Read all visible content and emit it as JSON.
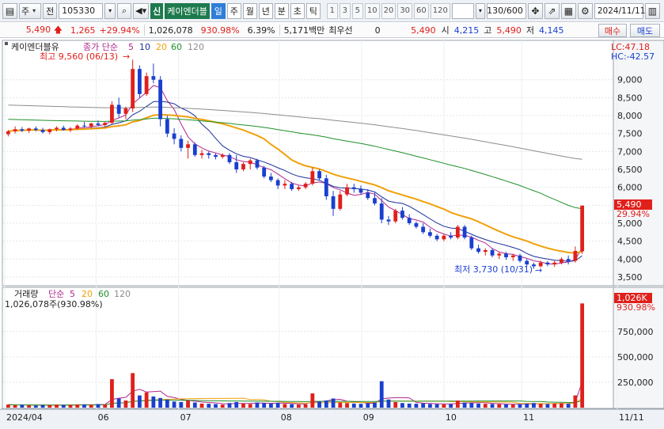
{
  "toolbar": {
    "market_label": "주",
    "type_label": "전",
    "code": "105330",
    "new_tag": "신",
    "stock_name": "케이엔더블",
    "periods": [
      "일",
      "주",
      "월",
      "년",
      "분",
      "초",
      "틱"
    ],
    "numbers": [
      "1",
      "3",
      "5",
      "10",
      "20",
      "30",
      "60",
      "120"
    ],
    "count_display": "130/600",
    "date": "2024/11/11"
  },
  "quote": {
    "price": "5,490",
    "change": "1,265",
    "change_pct": "+29.94%",
    "volume": "1,026,078",
    "volume_ratio": "930.98%",
    "turnover": "6.39%",
    "amount": "5,171백만",
    "priority_label": "최우선",
    "priority_value": "0",
    "last_price": "5,490",
    "open_label": "시",
    "open": "4,215",
    "high_label": "고",
    "high": "5,490",
    "low_label": "저",
    "low": "4,145",
    "buy_label": "매수",
    "sell_label": "매도"
  },
  "price_legend": {
    "name": "케이엔더블유",
    "ma_label": "종가 단순",
    "ma_periods": [
      "5",
      "10",
      "20",
      "60",
      "120"
    ],
    "lc": "LC:47.18",
    "hc": "HC:-42.57",
    "high_note": "최고 9,560 (06/13)",
    "low_note": "최저 3,730 (10/31)",
    "last_price_tag": "5,490",
    "last_pct_tag": "29.94%"
  },
  "volume_legend": {
    "name": "거래량",
    "ma_label": "단순",
    "ma_periods": [
      "5",
      "20",
      "60",
      "120"
    ],
    "value": "1,026,078주(930.98%)",
    "tag_value": "1,026K",
    "tag_pct": "930.98%"
  },
  "price_axis": [
    "9,000",
    "8,500",
    "8,000",
    "7,500",
    "7,000",
    "6,500",
    "6,000",
    "5,500",
    "5,000",
    "4,500",
    "4,000",
    "3,500"
  ],
  "volume_axis": [
    "750,000",
    "500,000",
    "250,000"
  ],
  "x_axis": [
    "2024/04",
    "06",
    "07",
    "08",
    "09",
    "10",
    "11",
    "11/11"
  ],
  "colors": {
    "up": "#e0201b",
    "down": "#1a3fcf",
    "ma5": "#b0288c",
    "ma10": "#1b2f9a",
    "ma20": "#f0a10b",
    "ma60": "#1f8f28",
    "ma120": "#8c8c8c"
  },
  "chart_data": {
    "type": "candlestick",
    "price_range": [
      3300,
      9700
    ],
    "volume_range": [
      0,
      1060000
    ],
    "candles": [
      [
        7480,
        7600,
        7420,
        7560
      ],
      [
        7560,
        7700,
        7500,
        7620
      ],
      [
        7620,
        7680,
        7540,
        7580
      ],
      [
        7580,
        7660,
        7520,
        7640
      ],
      [
        7640,
        7700,
        7560,
        7600
      ],
      [
        7600,
        7660,
        7500,
        7540
      ],
      [
        7540,
        7640,
        7480,
        7620
      ],
      [
        7620,
        7700,
        7560,
        7660
      ],
      [
        7660,
        7720,
        7580,
        7600
      ],
      [
        7600,
        7680,
        7540,
        7640
      ],
      [
        7640,
        7760,
        7600,
        7720
      ],
      [
        7720,
        7820,
        7660,
        7700
      ],
      [
        7700,
        7800,
        7640,
        7780
      ],
      [
        7780,
        7860,
        7700,
        7740
      ],
      [
        7740,
        7820,
        7680,
        7800
      ],
      [
        7800,
        8400,
        7760,
        8300
      ],
      [
        8300,
        8500,
        7950,
        8050
      ],
      [
        8050,
        8250,
        7900,
        8200
      ],
      [
        8200,
        9560,
        8100,
        9300
      ],
      [
        9300,
        9400,
        8500,
        8600
      ],
      [
        8600,
        9200,
        8550,
        9100
      ],
      [
        9100,
        9450,
        8900,
        9000
      ],
      [
        9000,
        9100,
        7700,
        7900
      ],
      [
        7900,
        8000,
        7400,
        7500
      ],
      [
        7500,
        7650,
        7200,
        7350
      ],
      [
        7350,
        7450,
        7000,
        7100
      ],
      [
        7100,
        7300,
        6800,
        7200
      ],
      [
        7200,
        7250,
        6850,
        6900
      ],
      [
        6900,
        7050,
        6800,
        6950
      ],
      [
        6950,
        7000,
        6800,
        6900
      ],
      [
        6900,
        6950,
        6780,
        6850
      ],
      [
        6850,
        6950,
        6800,
        6900
      ],
      [
        6900,
        6950,
        6650,
        6700
      ],
      [
        6700,
        6900,
        6400,
        6500
      ],
      [
        6500,
        6700,
        6450,
        6650
      ],
      [
        6650,
        6800,
        6500,
        6750
      ],
      [
        6750,
        6800,
        6500,
        6550
      ],
      [
        6550,
        6600,
        6250,
        6300
      ],
      [
        6300,
        6400,
        6150,
        6200
      ],
      [
        6200,
        6250,
        5950,
        6050
      ],
      [
        6050,
        6200,
        5950,
        6100
      ],
      [
        6100,
        6150,
        5900,
        5950
      ],
      [
        5950,
        6050,
        5900,
        6000
      ],
      [
        6000,
        6150,
        5950,
        6100
      ],
      [
        6100,
        6550,
        6050,
        6450
      ],
      [
        6450,
        6500,
        6200,
        6250
      ],
      [
        6250,
        6350,
        5650,
        5750
      ],
      [
        5750,
        5900,
        5200,
        5400
      ],
      [
        5400,
        5900,
        5350,
        5800
      ],
      [
        5800,
        6100,
        5750,
        6000
      ],
      [
        6000,
        6100,
        5850,
        5950
      ],
      [
        5950,
        6050,
        5800,
        5850
      ],
      [
        5850,
        5950,
        5650,
        5700
      ],
      [
        5700,
        5850,
        5500,
        5550
      ],
      [
        5550,
        5700,
        5000,
        5100
      ],
      [
        5100,
        5200,
        4950,
        5050
      ],
      [
        5050,
        5400,
        5000,
        5350
      ],
      [
        5350,
        5450,
        5100,
        5150
      ],
      [
        5150,
        5250,
        4950,
        5000
      ],
      [
        5000,
        5050,
        4850,
        4900
      ],
      [
        4900,
        5000,
        4700,
        4750
      ],
      [
        4750,
        4850,
        4600,
        4650
      ],
      [
        4650,
        4700,
        4500,
        4550
      ],
      [
        4550,
        4700,
        4500,
        4650
      ],
      [
        4650,
        4750,
        4550,
        4600
      ],
      [
        4600,
        4950,
        4550,
        4900
      ],
      [
        4900,
        4950,
        4550,
        4600
      ],
      [
        4600,
        4650,
        4250,
        4300
      ],
      [
        4300,
        4400,
        4150,
        4200
      ],
      [
        4200,
        4300,
        4100,
        4250
      ],
      [
        4250,
        4300,
        4050,
        4100
      ],
      [
        4100,
        4200,
        4000,
        4150
      ],
      [
        4150,
        4200,
        3980,
        4050
      ],
      [
        4050,
        4150,
        3950,
        4100
      ],
      [
        4100,
        4150,
        3900,
        3950
      ],
      [
        3950,
        4000,
        3800,
        3850
      ],
      [
        3850,
        3900,
        3730,
        3800
      ],
      [
        3800,
        3950,
        3760,
        3900
      ],
      [
        3900,
        3950,
        3800,
        3850
      ],
      [
        3850,
        3950,
        3780,
        3900
      ],
      [
        3900,
        4050,
        3850,
        4000
      ],
      [
        4000,
        4100,
        3850,
        3950
      ],
      [
        3950,
        4350,
        3900,
        4225
      ],
      [
        4215,
        5490,
        4145,
        5490
      ]
    ],
    "volumes": [
      30000,
      25000,
      28000,
      22000,
      20000,
      26000,
      24000,
      30000,
      27000,
      25000,
      32000,
      30000,
      28000,
      35000,
      30000,
      280000,
      90000,
      70000,
      340000,
      120000,
      150000,
      110000,
      95000,
      80000,
      60000,
      55000,
      70000,
      50000,
      40000,
      38000,
      35000,
      30000,
      45000,
      55000,
      40000,
      35000,
      50000,
      45000,
      40000,
      48000,
      36000,
      34000,
      30000,
      32000,
      140000,
      60000,
      70000,
      90000,
      50000,
      45000,
      40000,
      38000,
      42000,
      50000,
      260000,
      80000,
      55000,
      45000,
      40000,
      38000,
      42000,
      36000,
      34000,
      32000,
      35000,
      70000,
      50000,
      45000,
      40000,
      38000,
      36000,
      34000,
      32000,
      30000,
      35000,
      40000,
      45000,
      38000,
      36000,
      40000,
      42000,
      38000,
      120000,
      1026078
    ]
  }
}
